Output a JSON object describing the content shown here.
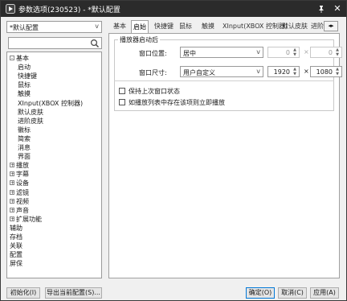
{
  "window": {
    "title": "参数选项(230523) - *默认配置",
    "pin_glyph": "📌",
    "close_glyph": "✕"
  },
  "left_panel": {
    "profile_value": "*默认配置",
    "search_placeholder": "",
    "tree": [
      {
        "label": "基本",
        "level": 0,
        "expander": "-"
      },
      {
        "label": "启动",
        "level": 1
      },
      {
        "label": "快捷键",
        "level": 1
      },
      {
        "label": "鼠标",
        "level": 1
      },
      {
        "label": "触摸",
        "level": 1
      },
      {
        "label": "XInput(XBOX 控制器)",
        "level": 1
      },
      {
        "label": "默认皮肤",
        "level": 1
      },
      {
        "label": "进阶皮肤",
        "level": 1
      },
      {
        "label": "徽标",
        "level": 1
      },
      {
        "label": "简索",
        "level": 1
      },
      {
        "label": "消息",
        "level": 1
      },
      {
        "label": "界面",
        "level": 1
      },
      {
        "label": "播放",
        "level": 0,
        "expander": "+"
      },
      {
        "label": "字幕",
        "level": 0,
        "expander": "+"
      },
      {
        "label": "设备",
        "level": 0,
        "expander": "+"
      },
      {
        "label": "滤镜",
        "level": 0,
        "expander": "+"
      },
      {
        "label": "视频",
        "level": 0,
        "expander": "+"
      },
      {
        "label": "声音",
        "level": 0,
        "expander": "+"
      },
      {
        "label": "扩展功能",
        "level": 0,
        "expander": "+"
      },
      {
        "label": "辅助",
        "level": 0
      },
      {
        "label": "存档",
        "level": 0
      },
      {
        "label": "关联",
        "level": 0
      },
      {
        "label": "配置",
        "level": 0
      },
      {
        "label": "屏保",
        "level": 0
      }
    ]
  },
  "tabs": {
    "items": [
      "基本",
      "启始",
      "快捷键",
      "鼠标",
      "触摸",
      "XInput(XBOX 控制器)",
      "默认皮肤",
      "进阶"
    ],
    "active_index": 1,
    "scroll_glyph": "◂▸"
  },
  "startup": {
    "group_title": "播放器启动后",
    "position_label": "窗口位置:",
    "position_value": "居中",
    "position_x": "0",
    "position_y": "0",
    "size_label": "窗口尺寸:",
    "size_value": "用户自定义",
    "size_w": "1920",
    "size_h": "1080",
    "times": "×",
    "keep_last_state": "保持上次窗口状态",
    "play_if_in_list": "如播放列表中存在该项则立即播放"
  },
  "buttons": {
    "init": "初始化(I)",
    "export": "导出当前配置(S)...",
    "ok": "确定(O)",
    "cancel": "取消(C)",
    "apply": "应用(A)"
  }
}
